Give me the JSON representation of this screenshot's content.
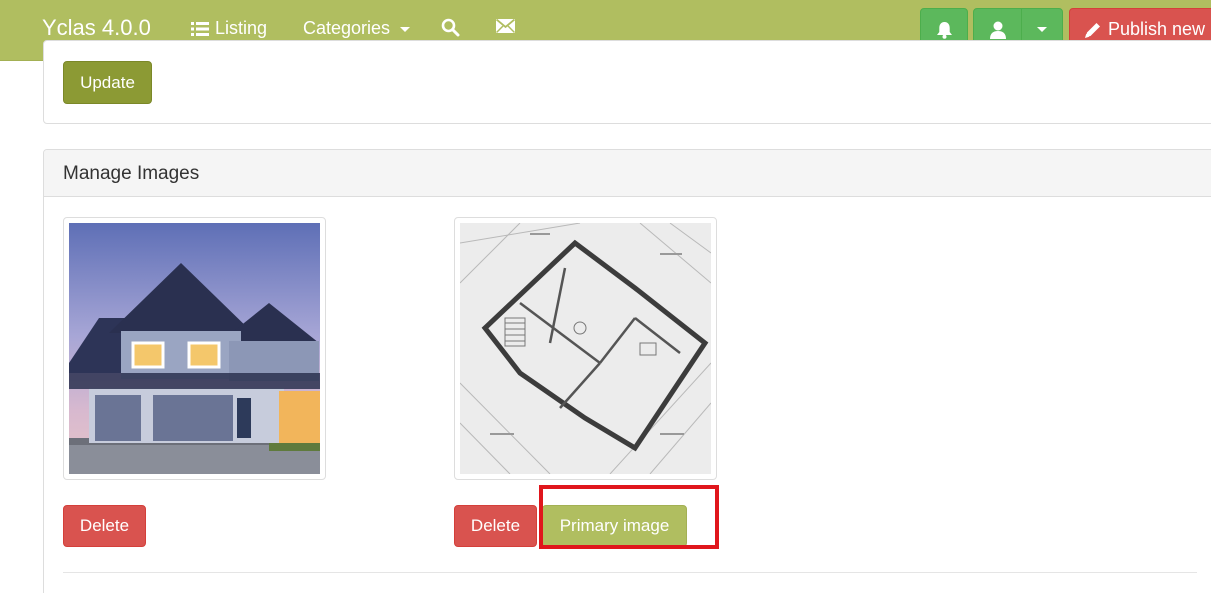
{
  "navbar": {
    "brand": "Yclas 4.0.0",
    "listing_label": "Listing",
    "categories_label": "Categories",
    "publish_label": "Publish new",
    "icons": [
      "list-icon",
      "chevron-down-icon",
      "search-icon",
      "envelope-icon",
      "bell-icon",
      "user-icon",
      "pencil-icon"
    ],
    "colors": {
      "navbar": "#b0be60",
      "green_button": "#5cb85c",
      "publish_button": "#d9534f"
    }
  },
  "top_panel": {
    "update_label": "Update"
  },
  "images_panel": {
    "title": "Manage Images",
    "images": [
      {
        "alt": "House photo",
        "delete_label": "Delete"
      },
      {
        "alt": "Floor plan",
        "delete_label": "Delete",
        "primary_label": "Primary image"
      }
    ]
  },
  "colors": {
    "delete_button": "#d9534f",
    "update_button": "#8c9a34",
    "primary_button": "#b0be60",
    "highlight": "#e0161c"
  }
}
